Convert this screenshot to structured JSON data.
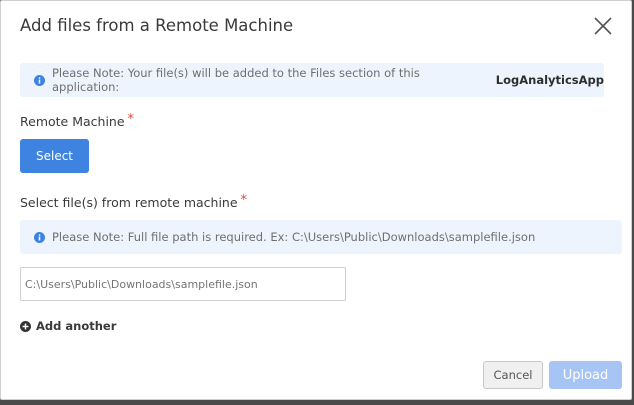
{
  "dialog": {
    "title": "Add files from a Remote Machine",
    "close_icon": "close-icon"
  },
  "app_note": {
    "icon": "info-icon",
    "text": "Please Note: Your file(s) will be added to the Files section of this application:",
    "app_name": "LogAnalyticsApp"
  },
  "remote_machine": {
    "label": "Remote Machine",
    "required_mark": "*",
    "select_label": "Select"
  },
  "files": {
    "label": "Select file(s) from remote machine",
    "required_mark": "*",
    "note_icon": "info-icon",
    "note_text": "Please Note: Full file path is required. Ex: C:\\Users\\Public\\Downloads\\samplefile.json",
    "path_placeholder": "C:\\Users\\Public\\Downloads\\samplefile.json",
    "path_value": "",
    "add_another_icon": "plus-circle-icon",
    "add_another_label": "Add another"
  },
  "footer": {
    "cancel_label": "Cancel",
    "upload_label": "Upload"
  },
  "colors": {
    "primary": "#3f83e0",
    "primary_disabled": "#a6c5f4",
    "note_bg": "#edf4fd",
    "required": "#e0463f"
  }
}
